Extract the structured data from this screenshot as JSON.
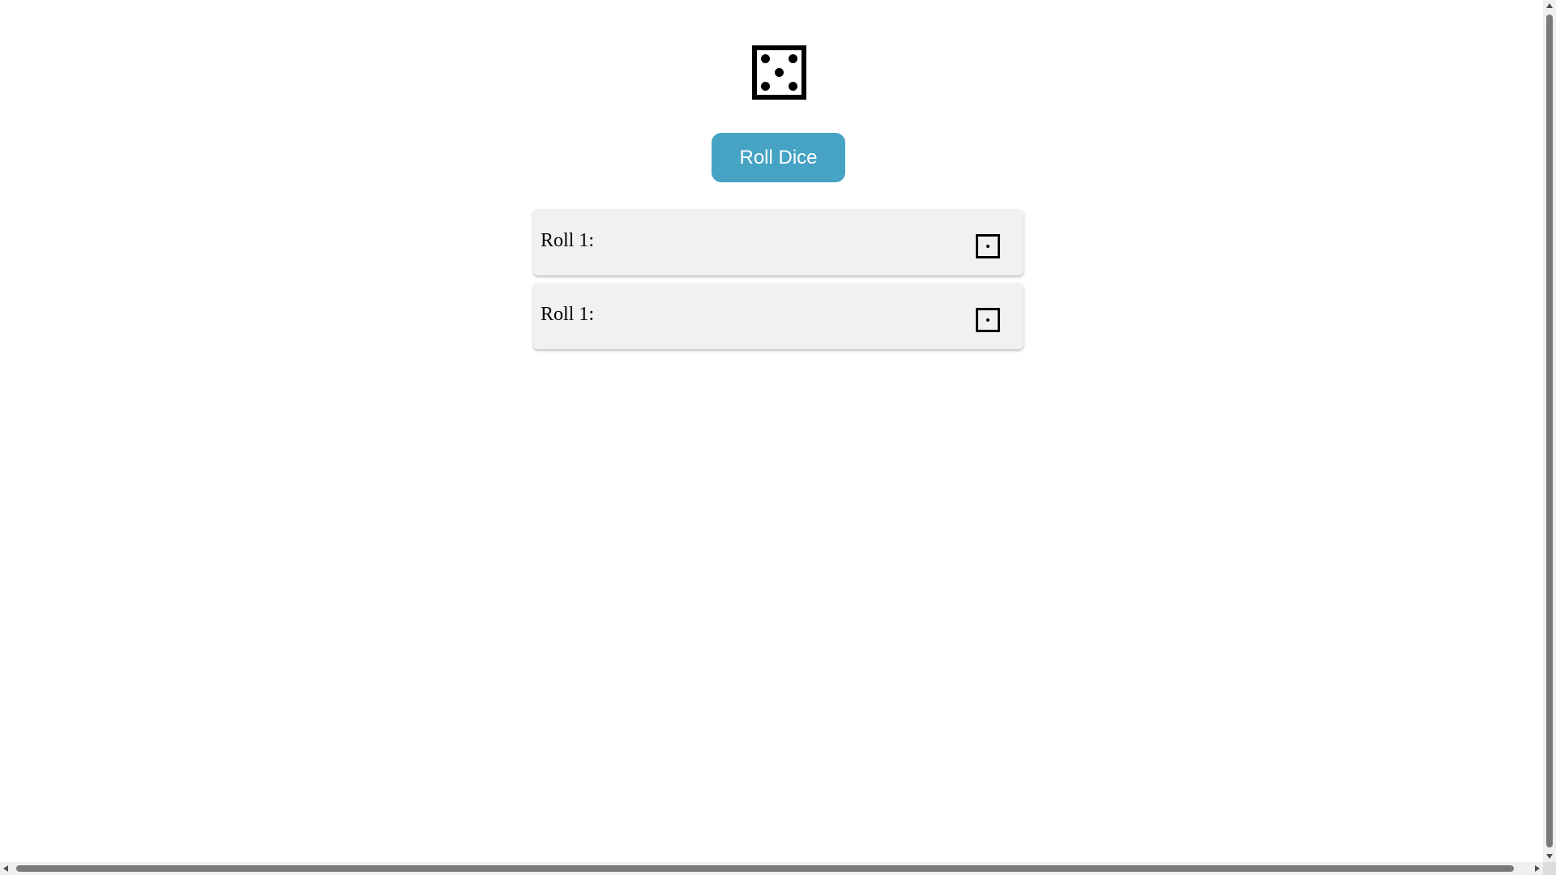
{
  "die": {
    "icon": "die-face-5-icon",
    "value": 5
  },
  "roll_button": {
    "label": "Roll Dice",
    "color": "#46a3c4"
  },
  "rolls": [
    {
      "label": "Roll 1:",
      "icon": "die-face-1-icon",
      "value": 1
    },
    {
      "label": "Roll 1:",
      "icon": "die-face-1-icon",
      "value": 1
    }
  ]
}
